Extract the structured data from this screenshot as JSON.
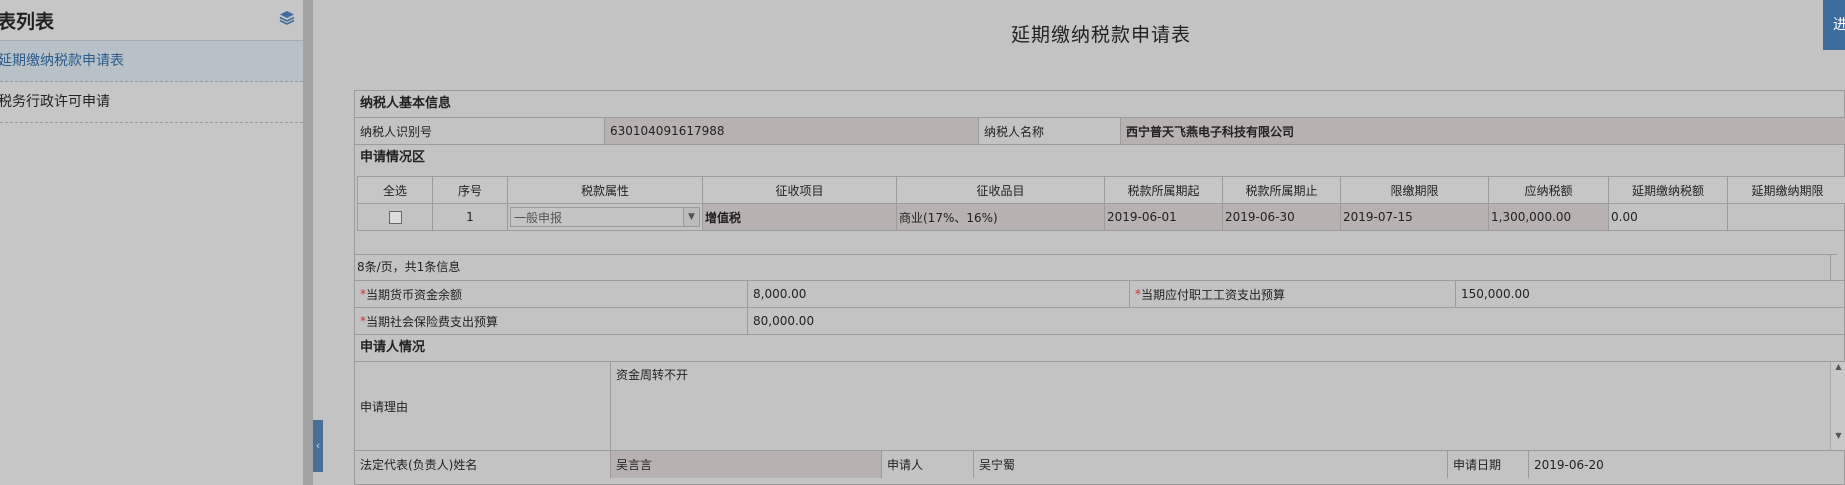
{
  "sidebar": {
    "title": "表列表",
    "items": [
      {
        "label": "延期缴纳税款申请表",
        "active": true
      },
      {
        "label": "税务行政许可申请",
        "active": false
      }
    ],
    "collapse_arrow": "‹"
  },
  "header": {
    "title": "延期缴纳税款申请表",
    "top_button": "进"
  },
  "taxpayer": {
    "section": "纳税人基本信息",
    "id_label": "纳税人识别号",
    "id_value": "630104091617988",
    "name_label": "纳税人名称",
    "name_value": "西宁普天飞燕电子科技有限公司"
  },
  "application": {
    "section": "申请情况区",
    "columns": [
      "全选",
      "序号",
      "税款属性",
      "征收项目",
      "征收品目",
      "税款所属期起",
      "税款所属期止",
      "限缴期限",
      "应纳税额",
      "延期缴纳税额",
      "延期缴纳期限"
    ],
    "rows": [
      {
        "seq": "1",
        "attr": "一般申报",
        "item": "增值税",
        "category": "商业(17%、16%)",
        "period_start": "2019-06-01",
        "period_end": "2019-06-30",
        "deadline": "2019-07-15",
        "tax_due": "1,300,000.00",
        "deferred_amount": "0.00",
        "deferred_deadline": ""
      }
    ],
    "pager": "8条/页，共1条信息"
  },
  "funds": {
    "cash_label": "当期货币资金余额",
    "cash_value": "8,000.00",
    "salary_label": "当期应付职工工资支出预算",
    "salary_value": "150,000.00",
    "insurance_label": "当期社会保险费支出预算",
    "insurance_value": "80,000.00"
  },
  "applicant": {
    "section": "申请人情况",
    "reason_label": "申请理由",
    "reason_value": "资金周转不开",
    "legal_rep_label": "法定代表(负责人)姓名",
    "legal_rep_value": "吴言言",
    "applicant_label": "申请人",
    "applicant_value": "吴宁蜀",
    "date_label": "申请日期",
    "date_value": "2019-06-20"
  },
  "colors": {
    "accent": "#3e6c9c",
    "readonly_cell": "#b8b1b1",
    "required_mark": "#cc3333"
  }
}
